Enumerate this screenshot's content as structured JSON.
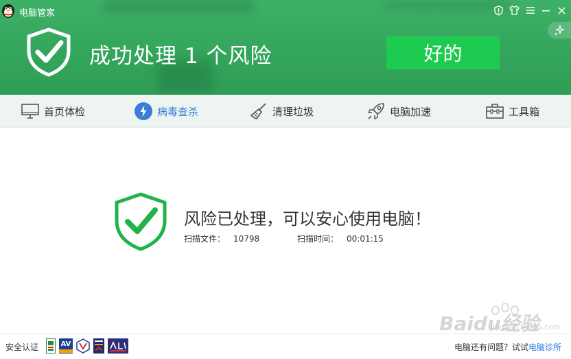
{
  "app": {
    "title": "电脑管家"
  },
  "header": {
    "result_title": "成功处理 1 个风险",
    "ok_button": "好的"
  },
  "nav": {
    "items": [
      {
        "label": "首页体检",
        "icon": "monitor-icon",
        "active": false
      },
      {
        "label": "病毒查杀",
        "icon": "lightning-icon",
        "active": true
      },
      {
        "label": "清理垃圾",
        "icon": "broom-icon",
        "active": false
      },
      {
        "label": "电脑加速",
        "icon": "rocket-icon",
        "active": false
      },
      {
        "label": "工具箱",
        "icon": "toolbox-icon",
        "active": false
      }
    ]
  },
  "main": {
    "message": "风险已处理，可以安心使用电脑！",
    "scan_files_label": "扫描文件：",
    "scan_files_value": "10798",
    "scan_time_label": "扫描时间：",
    "scan_time_value": "00:01:15"
  },
  "footer": {
    "cert_label": "安全认证",
    "badges": [
      "gb-badge",
      "av-badge",
      "vb-badge",
      "cert-badge",
      "award-badge"
    ],
    "badge_av_text": "AV",
    "help_text": "电脑还有问题？试试",
    "help_link": "电脑诊所"
  },
  "watermark": {
    "text": "Baidu经验",
    "sub": "jingyan.baidu.com"
  },
  "colors": {
    "header_green": "#34a65c",
    "ok_button_green": "#1ecb51",
    "shield_green": "#21b34a",
    "active_blue": "#3a7cd6",
    "link_blue": "#2f7ad8"
  }
}
